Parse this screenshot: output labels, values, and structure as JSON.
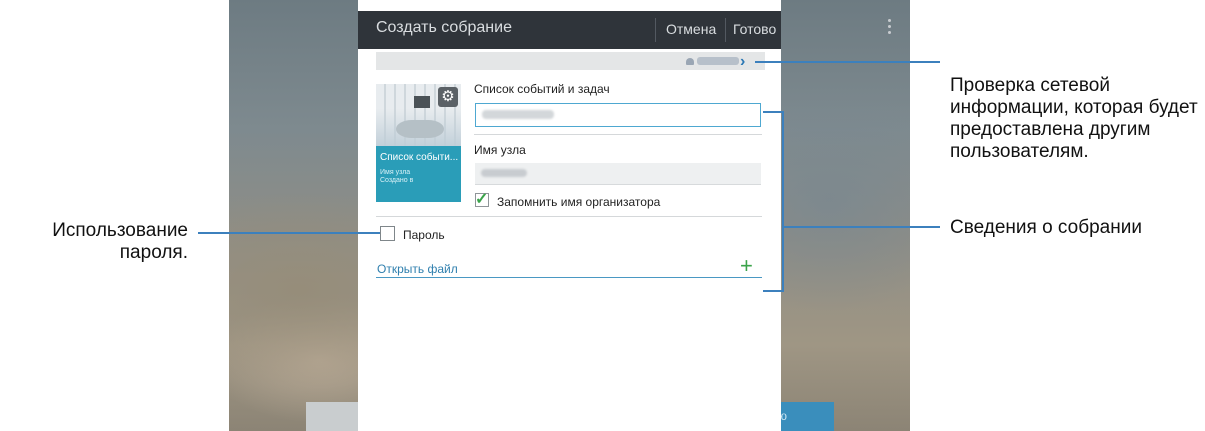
{
  "dialog": {
    "title": "Создать собрание",
    "cancel_label": "Отмена",
    "done_label": "Готово",
    "events_label": "Список событий и задач",
    "host_label": "Имя узла",
    "remember_label": "Запомнить имя организатора",
    "remember_checked": true,
    "password_label": "Пароль",
    "password_checked": false,
    "open_file_label": "Открыть файл",
    "add_symbol": "+"
  },
  "thumbnail": {
    "title": "Список событи...",
    "line1": "Имя узла",
    "line2": "Создано в"
  },
  "callouts": {
    "network": "Проверка сетевой информации, которая будет предоставлена другим пользователям.",
    "meeting": "Сведения о собрании",
    "password": "Использование пароля."
  },
  "background": {
    "right_button_fragment": "ю"
  },
  "icons": {
    "menu": "overflow-menu-icon",
    "gear": "gear-icon",
    "chevron": "chevron-right-icon",
    "wifi": "wifi-icon",
    "check": "check-icon",
    "plus": "plus-icon"
  },
  "colors": {
    "title_bar": "#2f343a",
    "accent": "#3c80bd",
    "check_green": "#3aa34a",
    "thumb_caption": "#2a9db8"
  }
}
